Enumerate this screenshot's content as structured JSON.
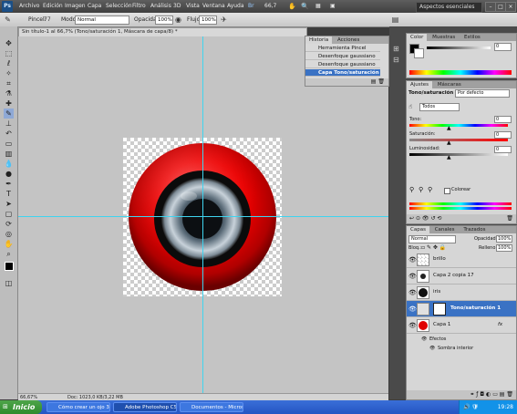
{
  "menubar": {
    "app_badge": "Ps",
    "items": [
      "Archivo",
      "Edición",
      "Imagen",
      "Capa",
      "Selección",
      "Filtro",
      "Análisis",
      "3D",
      "Vista",
      "Ventana",
      "Ayuda"
    ],
    "zoom": "66,7",
    "workspace": "Aspectos esenciales"
  },
  "options": {
    "tool_label": "Pincel:",
    "brush_size": "77",
    "mode_label": "Modo:",
    "mode_value": "Normal",
    "opacity_label": "Opacidad:",
    "opacity_value": "100%",
    "flow_label": "Flujo:",
    "flow_value": "100%"
  },
  "document": {
    "tab_title": "Sin título-1 al 66,7% (Tono/saturación 1, Máscara de capa/8) *",
    "zoom_status": "66,67%",
    "doc_status": "Doc: 1023,0 KB/3,22 MB"
  },
  "history": {
    "tabs": [
      "Historia",
      "Acciones"
    ],
    "rows": [
      "Herramienta Pincel",
      "Desenfoque gaussiano",
      "Desenfoque gaussiano",
      "Capa Tono/saturación 1"
    ],
    "selected": 3
  },
  "color_panel": {
    "tabs": [
      "Color",
      "Muestras",
      "Estilos"
    ],
    "value": "0"
  },
  "adjust_panel": {
    "tabs": [
      "Ajustes",
      "Máscaras"
    ],
    "title": "Tono/saturación",
    "preset": "Por defecto",
    "channel": "Todos",
    "hue_label": "Tono:",
    "hue_value": "0",
    "sat_label": "Saturación:",
    "sat_value": "0",
    "light_label": "Luminosidad:",
    "light_value": "0",
    "colorize_label": "Colorear"
  },
  "layers_panel": {
    "tabs": [
      "Capas",
      "Canales",
      "Trazados"
    ],
    "blend": "Normal",
    "opacity_label": "Opacidad:",
    "opacity_value": "100%",
    "lock_label": "Bloq.:",
    "fill_label": "Relleno:",
    "fill_value": "100%",
    "layers": [
      "brillo",
      "Capa 2 copia 17",
      "iris",
      "Tono/saturación 1",
      "Capa 1"
    ],
    "effects_label": "Efectos",
    "effect_item": "Sombra interior",
    "fx": "fx"
  },
  "taskbar": {
    "start_label": "Inicio",
    "tasks": [
      "Cómo crear un ojo 3D...",
      "Adobe Photoshop CS...",
      "Documentos - Micros..."
    ],
    "clock": "19:28"
  }
}
